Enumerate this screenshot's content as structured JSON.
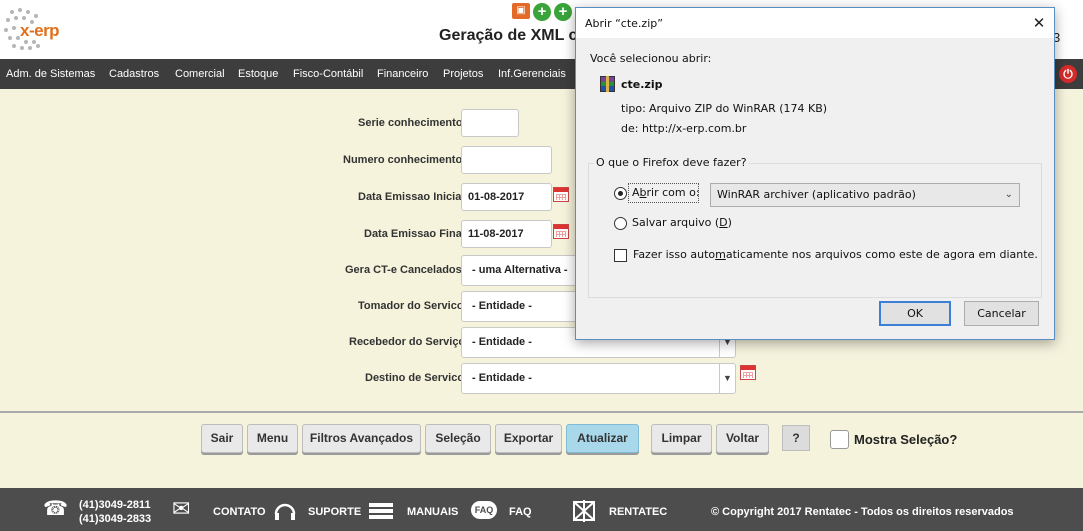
{
  "header": {
    "logo_text": "x-erp",
    "title": "Geração de XML c",
    "title_right": "3"
  },
  "menu": {
    "items": [
      "Adm. de Sistemas",
      "Cadastros",
      "Comercial",
      "Estoque",
      "Fisco-Contábil",
      "Financeiro",
      "Projetos",
      "Inf.Gerenciais"
    ]
  },
  "form": {
    "serie_label": "Serie conhecimento",
    "serie_value": "",
    "numero_label": "Numero conhecimento",
    "numero_value": "",
    "data_inicial_label": "Data Emissao Inicial",
    "data_inicial_value": "01-08-2017",
    "data_final_label": "Data Emissao Final",
    "data_final_value": "11-08-2017",
    "gera_label": "Gera CT-e Cancelados?",
    "gera_value": "- uma Alternativa -",
    "tomador_label": "Tomador do Servico",
    "tomador_value": "- Entidade -",
    "recebedor_label": "Recebedor do Serviço",
    "recebedor_value": "- Entidade -",
    "destino_label": "Destino de Servico",
    "destino_value": "- Entidade -"
  },
  "buttons": {
    "sair": "Sair",
    "menu": "Menu",
    "filtros": "Filtros Avançados",
    "selecao": "Seleção",
    "exportar": "Exportar",
    "atualizar": "Atualizar",
    "limpar": "Limpar",
    "voltar": "Voltar",
    "help": "?",
    "mostra_selecao": "Mostra Seleção?"
  },
  "footer": {
    "phone1": "(41)3049-2811",
    "phone2": "(41)3049-2833",
    "contato": "CONTATO",
    "suporte": "SUPORTE",
    "manuais": "MANUAIS",
    "faq_badge": "FAQ",
    "faq": "FAQ",
    "rentatec": "RENTATEC",
    "copyright": "© Copyright 2017 Rentatec - Todos os direitos reservados"
  },
  "dialog": {
    "title": "Abrir “cte.zip”",
    "close": "✕",
    "selected_label": "Você selecionou abrir:",
    "filename": "cte.zip",
    "tipo_label": "tipo:",
    "tipo_value": "Arquivo ZIP do WinRAR (174 KB)",
    "de_label": "de:",
    "de_value": "http://x-erp.com.br",
    "question": "O que o Firefox deve fazer?",
    "open_with_pre": "A",
    "open_with_u": "b",
    "open_with_post": "rir com o:",
    "app_option": "WinRAR archiver (aplicativo padrão)",
    "save_pre": "Salvar arquivo (",
    "save_u": "D",
    "save_post": ")",
    "auto_pre": "Fazer isso auto",
    "auto_u": "m",
    "auto_post": "aticamente nos arquivos como este de agora em diante.",
    "ok": "OK",
    "cancel": "Cancelar"
  },
  "colors": {
    "background": "#f5f3dc",
    "menubar": "#3d3d3d",
    "footer": "#4d4d4d",
    "accent_button": "#a8d8ea",
    "logo_orange": "#e0701c"
  }
}
